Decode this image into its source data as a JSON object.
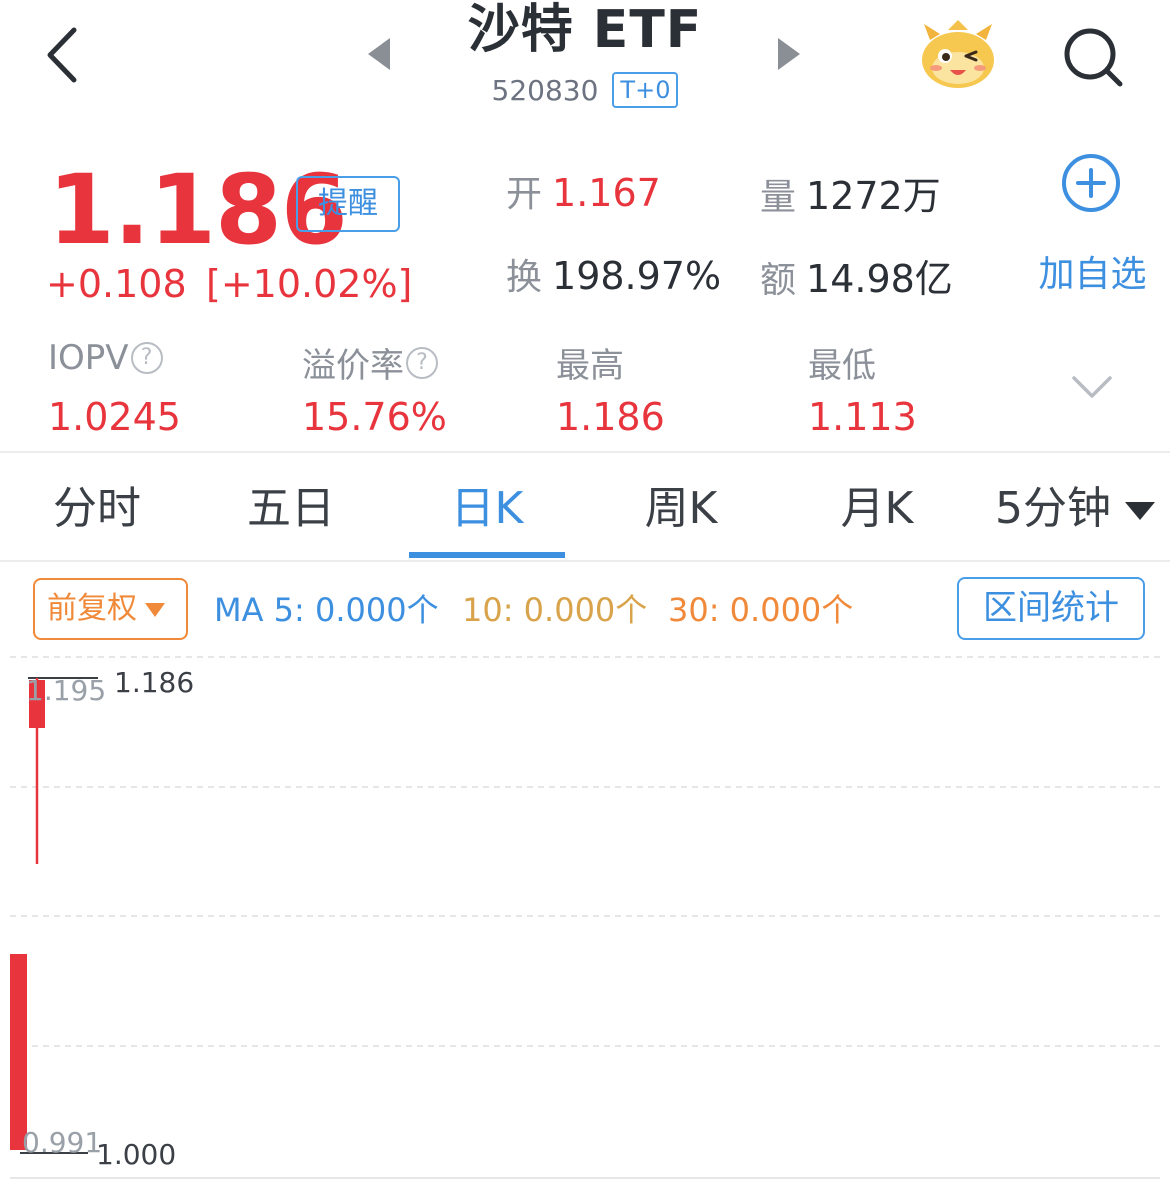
{
  "header": {
    "title": "沙特 ETF",
    "code": "520830",
    "trade_badge": "T+0"
  },
  "quote": {
    "price": "1.186",
    "alert_label": "提醒",
    "change": "+0.108",
    "change_pct": "[+10.02%]",
    "open_label": "开",
    "open": "1.167",
    "volume_label": "量",
    "volume": "1272万",
    "turnover_label": "换",
    "turnover": "198.97%",
    "amount_label": "额",
    "amount": "14.98亿",
    "add_watch_label": "加自选"
  },
  "metrics": [
    {
      "label": "IOPV",
      "value": "1.0245",
      "has_help": true
    },
    {
      "label": "溢价率",
      "value": "15.76%",
      "has_help": true
    },
    {
      "label": "最高",
      "value": "1.186",
      "has_help": false
    },
    {
      "label": "最低",
      "value": "1.113",
      "has_help": false
    }
  ],
  "tabs": [
    {
      "label": "分时",
      "active": false
    },
    {
      "label": "五日",
      "active": false
    },
    {
      "label": "日K",
      "active": true
    },
    {
      "label": "周K",
      "active": false
    },
    {
      "label": "月K",
      "active": false
    },
    {
      "label": "5分钟",
      "active": false
    }
  ],
  "indicators": {
    "adjust_label": "前复权",
    "ma5": "MA 5: 0.000个",
    "ma10": "10: 0.000个",
    "ma30": "30: 0.000个",
    "range_stats_label": "区间统计"
  },
  "chart": {
    "axis_top": "1.195",
    "axis_bottom": "0.991",
    "high_label": "1.186",
    "low_label": "1.000"
  },
  "colors": {
    "up_red": "#e8343c",
    "accent_blue": "#3d8fe0",
    "orange": "#f08a3a",
    "gold": "#d8a34a"
  },
  "icons": [
    "back-arrow-icon",
    "prev-arrow-icon",
    "next-arrow-icon",
    "mascot-icon",
    "search-icon",
    "add-circle-icon",
    "help-icon",
    "chevron-down-icon",
    "dropdown-caret-icon"
  ]
}
